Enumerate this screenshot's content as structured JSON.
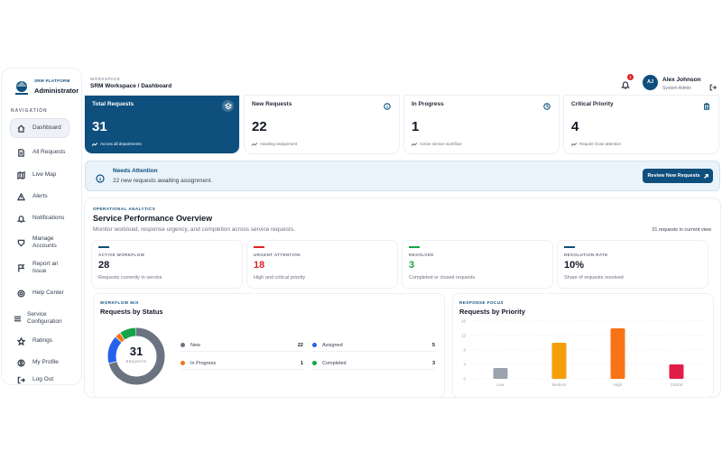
{
  "brand": {
    "sub": "SRM PLATFORM",
    "title": "Administrator"
  },
  "nav": {
    "heading": "NAVIGATION",
    "items": [
      {
        "label": "Dashboard",
        "icon": "home-icon"
      },
      {
        "label": "All Requests",
        "icon": "document-icon"
      },
      {
        "label": "Live Map",
        "icon": "map-icon"
      },
      {
        "label": "Alerts",
        "icon": "alert-triangle-icon"
      },
      {
        "label": "Notifications",
        "icon": "bell-icon"
      },
      {
        "label": "Manage Accounts",
        "icon": "users-icon"
      },
      {
        "label": "Report an Issue",
        "icon": "flag-icon"
      },
      {
        "label": "Help Center",
        "icon": "help-icon"
      },
      {
        "label": "Service Configuration",
        "icon": "sliders-icon"
      },
      {
        "label": "Ratings",
        "icon": "star-icon"
      },
      {
        "label": "My Profile",
        "icon": "user-icon"
      },
      {
        "label": "Log Out",
        "icon": "logout-icon"
      }
    ]
  },
  "header": {
    "workspace_small": "WORKSPACE",
    "title": "SRM Workspace / Dashboard",
    "notification_count": "1",
    "user": {
      "initials": "AJ",
      "name": "Alex Johnson",
      "role": "System Admin"
    }
  },
  "stats": [
    {
      "title": "Total Requests",
      "value": "31",
      "note": "Across all departments",
      "icon": "layers-icon"
    },
    {
      "title": "New Requests",
      "value": "22",
      "note": "Awaiting assignment",
      "icon": "info-icon"
    },
    {
      "title": "In Progress",
      "value": "1",
      "note": "Active service workflow",
      "icon": "clock-icon"
    },
    {
      "title": "Critical Priority",
      "value": "4",
      "note": "Require close attention",
      "icon": "clipboard-icon"
    }
  ],
  "banner": {
    "title": "Needs Attention",
    "text": "22 new requests awaiting assignment.",
    "button": "Review New Requests"
  },
  "analytics": {
    "kicker": "OPERATIONAL ANALYTICS",
    "title": "Service Performance Overview",
    "subtitle": "Monitor workload, response urgency, and completion across service requests.",
    "count_label": "31 requests in current view",
    "mini_cards": [
      {
        "label": "ACTIVE WORKFLOW",
        "value": "28",
        "note": "Requests currently in service",
        "color": "#0e4f7d"
      },
      {
        "label": "URGENT ATTENTION",
        "value": "18",
        "note": "High and critical priority",
        "color": "#dc2626"
      },
      {
        "label": "RESOLVED",
        "value": "3",
        "note": "Completed or closed requests",
        "color": "#16a34a"
      },
      {
        "label": "RESOLUTION RATE",
        "value": "10%",
        "note": "Share of requests resolved",
        "color": "#0e4f7d"
      }
    ],
    "status_panel": {
      "kicker": "WORKFLOW MIX",
      "title": "Requests by Status",
      "center_value": "31",
      "center_label": "REQUESTS"
    },
    "priority_panel": {
      "kicker": "RESPONSE FOCUS",
      "title": "Requests by Priority"
    }
  },
  "chart_data": [
    {
      "type": "pie",
      "title": "Requests by Status",
      "categories": [
        "New",
        "Assigned",
        "In Progress",
        "Completed"
      ],
      "values": [
        22,
        5,
        1,
        3
      ],
      "colors": [
        "#6b7280",
        "#2563eb",
        "#f97316",
        "#16a34a"
      ]
    },
    {
      "type": "bar",
      "title": "Requests by Priority",
      "categories": [
        "Low",
        "Medium",
        "High",
        "Critical"
      ],
      "values": [
        3,
        10,
        14,
        4
      ],
      "colors": [
        "#9ca3af",
        "#f59e0b",
        "#f97316",
        "#e11d48"
      ],
      "ylim": [
        0,
        16
      ],
      "yticks": [
        0,
        4,
        8,
        12,
        16
      ],
      "grid": true
    }
  ]
}
